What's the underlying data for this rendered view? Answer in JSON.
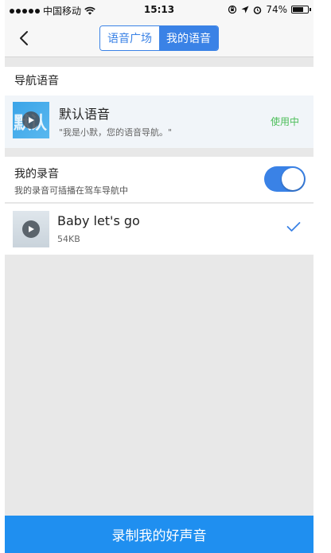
{
  "status_bar": {
    "carrier": "中国移动",
    "time": "15:13",
    "battery": "74%",
    "battery_level": 0.74
  },
  "nav": {
    "tabs": [
      {
        "label": "语音广场",
        "active": false
      },
      {
        "label": "我的语音",
        "active": true
      }
    ]
  },
  "nav_voice": {
    "section_title": "导航语音",
    "item": {
      "title": "默认语音",
      "subtitle": "\"我是小默，您的语音导航。\"",
      "status": "使用中",
      "thumb_text": "默认"
    }
  },
  "my_recordings": {
    "title": "我的录音",
    "subtitle": "我的录音可插播在驾车导航中",
    "toggle_on": true,
    "items": [
      {
        "name": "Baby let's go",
        "size": "54KB",
        "selected": true
      }
    ]
  },
  "bottom_button": {
    "label": "录制我的好声音"
  },
  "colors": {
    "accent": "#3a82e6",
    "in_use": "#4cbe59",
    "bottom_button": "#1f8ff0"
  }
}
